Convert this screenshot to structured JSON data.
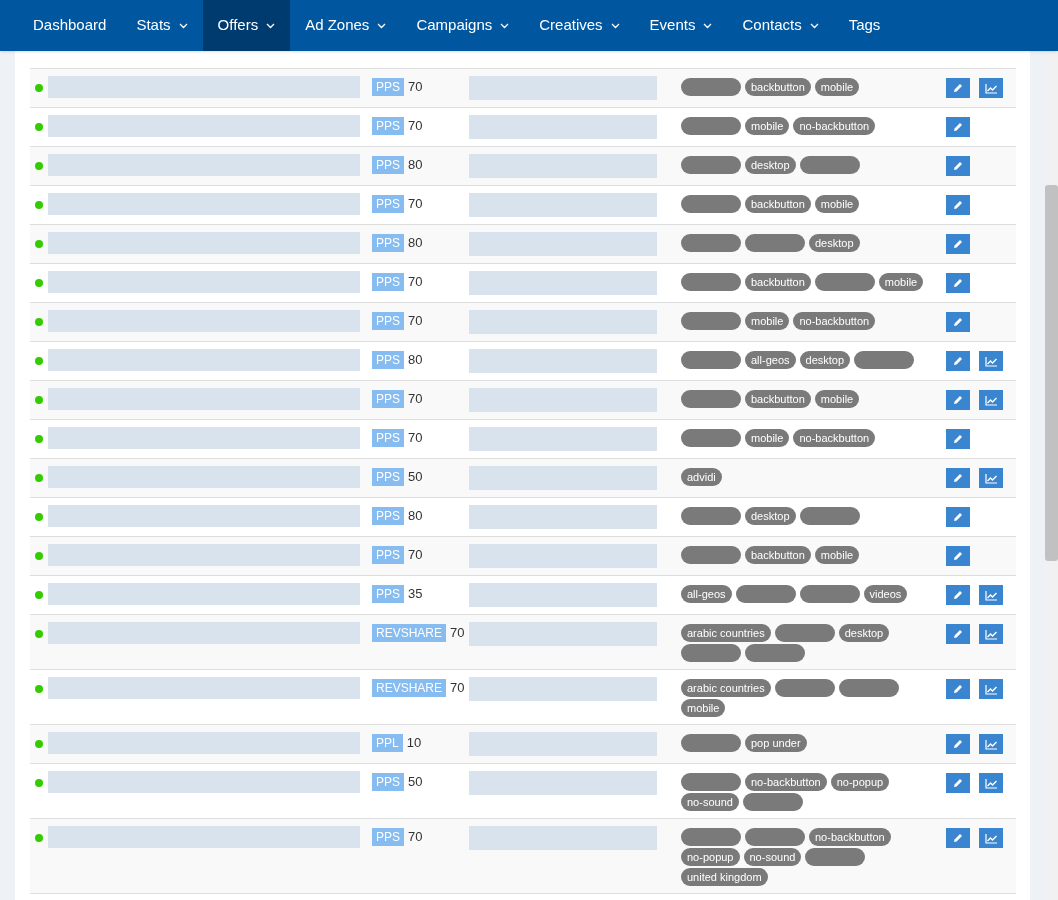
{
  "nav": [
    {
      "label": "Dashboard",
      "menu": false,
      "selected": false
    },
    {
      "label": "Stats",
      "menu": true,
      "selected": false
    },
    {
      "label": "Offers",
      "menu": true,
      "selected": true
    },
    {
      "label": "Ad Zones",
      "menu": true,
      "selected": false
    },
    {
      "label": "Campaigns",
      "menu": true,
      "selected": false
    },
    {
      "label": "Creatives",
      "menu": true,
      "selected": false
    },
    {
      "label": "Events",
      "menu": true,
      "selected": false
    },
    {
      "label": "Contacts",
      "menu": true,
      "selected": false
    },
    {
      "label": "Tags",
      "menu": false,
      "selected": false
    }
  ],
  "rows": [
    {
      "active": true,
      "type": "PPS",
      "value": "70",
      "stats": true,
      "tags": [
        {
          "kind": "hidden"
        },
        {
          "kind": "text",
          "label": "backbutton"
        },
        {
          "kind": "text",
          "label": "mobile"
        }
      ]
    },
    {
      "active": true,
      "type": "PPS",
      "value": "70",
      "stats": false,
      "tags": [
        {
          "kind": "hidden"
        },
        {
          "kind": "text",
          "label": "mobile"
        },
        {
          "kind": "text",
          "label": "no-backbutton"
        }
      ]
    },
    {
      "active": true,
      "type": "PPS",
      "value": "80",
      "stats": false,
      "tags": [
        {
          "kind": "hidden"
        },
        {
          "kind": "text",
          "label": "desktop"
        },
        {
          "kind": "hidden"
        }
      ]
    },
    {
      "active": true,
      "type": "PPS",
      "value": "70",
      "stats": false,
      "tags": [
        {
          "kind": "hidden"
        },
        {
          "kind": "text",
          "label": "backbutton"
        },
        {
          "kind": "text",
          "label": "mobile"
        }
      ]
    },
    {
      "active": true,
      "type": "PPS",
      "value": "80",
      "stats": false,
      "tags": [
        {
          "kind": "hidden"
        },
        {
          "kind": "hidden"
        },
        {
          "kind": "text",
          "label": "desktop"
        }
      ]
    },
    {
      "active": true,
      "type": "PPS",
      "value": "70",
      "stats": false,
      "tags": [
        {
          "kind": "hidden"
        },
        {
          "kind": "text",
          "label": "backbutton"
        },
        {
          "kind": "hidden"
        },
        {
          "kind": "text",
          "label": "mobile"
        }
      ]
    },
    {
      "active": true,
      "type": "PPS",
      "value": "70",
      "stats": false,
      "tags": [
        {
          "kind": "hidden"
        },
        {
          "kind": "text",
          "label": "mobile"
        },
        {
          "kind": "text",
          "label": "no-backbutton"
        }
      ]
    },
    {
      "active": true,
      "type": "PPS",
      "value": "80",
      "stats": true,
      "tags": [
        {
          "kind": "hidden"
        },
        {
          "kind": "text",
          "label": "all-geos"
        },
        {
          "kind": "text",
          "label": "desktop"
        },
        {
          "kind": "hidden"
        }
      ]
    },
    {
      "active": true,
      "type": "PPS",
      "value": "70",
      "stats": true,
      "tags": [
        {
          "kind": "hidden"
        },
        {
          "kind": "text",
          "label": "backbutton"
        },
        {
          "kind": "text",
          "label": "mobile"
        }
      ]
    },
    {
      "active": true,
      "type": "PPS",
      "value": "70",
      "stats": false,
      "tags": [
        {
          "kind": "hidden"
        },
        {
          "kind": "text",
          "label": "mobile"
        },
        {
          "kind": "text",
          "label": "no-backbutton"
        }
      ]
    },
    {
      "active": true,
      "type": "PPS",
      "value": "50",
      "stats": true,
      "tags": [
        {
          "kind": "text",
          "label": "advidi"
        }
      ]
    },
    {
      "active": true,
      "type": "PPS",
      "value": "80",
      "stats": false,
      "tags": [
        {
          "kind": "hidden"
        },
        {
          "kind": "text",
          "label": "desktop"
        },
        {
          "kind": "hidden"
        }
      ]
    },
    {
      "active": true,
      "type": "PPS",
      "value": "70",
      "stats": false,
      "tags": [
        {
          "kind": "hidden"
        },
        {
          "kind": "text",
          "label": "backbutton"
        },
        {
          "kind": "text",
          "label": "mobile"
        }
      ]
    },
    {
      "active": true,
      "type": "PPS",
      "value": "35",
      "stats": true,
      "tags": [
        {
          "kind": "text",
          "label": "all-geos"
        },
        {
          "kind": "hidden"
        },
        {
          "kind": "hidden"
        },
        {
          "kind": "text",
          "label": "videos"
        }
      ]
    },
    {
      "active": true,
      "type": "REVSHARE",
      "value": "70",
      "stats": true,
      "tags": [
        {
          "kind": "text",
          "label": "arabic countries"
        },
        {
          "kind": "hidden"
        },
        {
          "kind": "text",
          "label": "desktop"
        },
        {
          "kind": "hidden"
        },
        {
          "kind": "hidden"
        }
      ]
    },
    {
      "active": true,
      "type": "REVSHARE",
      "value": "70",
      "stats": true,
      "tags": [
        {
          "kind": "text",
          "label": "arabic countries"
        },
        {
          "kind": "hidden"
        },
        {
          "kind": "hidden"
        },
        {
          "kind": "text",
          "label": "mobile"
        }
      ]
    },
    {
      "active": true,
      "type": "PPL",
      "value": "10",
      "stats": true,
      "tags": [
        {
          "kind": "hidden"
        },
        {
          "kind": "text",
          "label": "pop under"
        }
      ]
    },
    {
      "active": true,
      "type": "PPS",
      "value": "50",
      "stats": true,
      "tags": [
        {
          "kind": "hidden"
        },
        {
          "kind": "text",
          "label": "no-backbutton"
        },
        {
          "kind": "text",
          "label": "no-popup"
        },
        {
          "kind": "text",
          "label": "no-sound"
        },
        {
          "kind": "hidden"
        }
      ]
    },
    {
      "active": true,
      "type": "PPS",
      "value": "70",
      "stats": true,
      "tags": [
        {
          "kind": "hidden"
        },
        {
          "kind": "hidden"
        },
        {
          "kind": "text",
          "label": "no-backbutton"
        },
        {
          "kind": "text",
          "label": "no-popup"
        },
        {
          "kind": "text",
          "label": "no-sound"
        },
        {
          "kind": "hidden"
        },
        {
          "kind": "text",
          "label": "united kingdom"
        }
      ]
    }
  ]
}
